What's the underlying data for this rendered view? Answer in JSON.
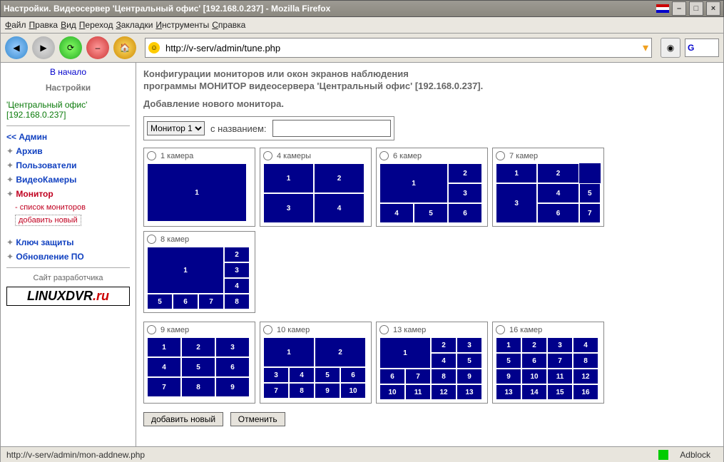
{
  "window_title": "Настройки. Видеосервер 'Центральный офис' [192.168.0.237] - Mozilla Firefox",
  "menu": [
    "Файл",
    "Правка",
    "Вид",
    "Переход",
    "Закладки",
    "Инструменты",
    "Справка"
  ],
  "url": "http://v-serv/admin/tune.php",
  "search_hint": "G",
  "sidebar": {
    "home": "В начало",
    "settings": "Настройки",
    "server_name": "'Центральный офис'",
    "server_ip": "[192.168.0.237]",
    "admin": "<<  Админ",
    "items": [
      {
        "label": "Архив"
      },
      {
        "label": "Пользователи"
      },
      {
        "label": "ВидеоКамеры"
      },
      {
        "label": "Монитор",
        "red": true,
        "subs": [
          {
            "label": "- список мониторов"
          },
          {
            "label": "добавить новый",
            "boxed": true
          }
        ]
      },
      {
        "label": "Ключ защиты"
      },
      {
        "label": "Обновление ПО"
      }
    ],
    "dev": "Сайт разработчика",
    "logo_a": "LINUXDVR",
    "logo_b": ".ru"
  },
  "main": {
    "line1": "Конфигурации мониторов или окон экранов наблюдения",
    "line2": "программы МОНИТОР видеосервера 'Центральный офис' [192.168.0.237].",
    "line3": "Добавление нового монитора.",
    "select_label": "Монитор 1",
    "name_label": "с названием:",
    "name_value": "",
    "layouts": [
      {
        "label": "1 камера",
        "grid": [
          [
            1
          ]
        ],
        "w": 138,
        "h": 80
      },
      {
        "label": "4 камеры",
        "grid": [
          [
            1,
            2
          ],
          [
            3,
            4
          ]
        ],
        "cw": 69,
        "ch": 40
      },
      {
        "label": "6 камер",
        "grid6": true
      },
      {
        "label": "7 камер",
        "grid7": true
      },
      {
        "label": "8 камер",
        "grid8": true
      },
      {
        "label": "9 камер",
        "grid": [
          [
            1,
            2,
            3
          ],
          [
            4,
            5,
            6
          ],
          [
            7,
            8,
            9
          ]
        ],
        "cw": 46,
        "ch": 26
      },
      {
        "label": "10 камер",
        "grid10": true
      },
      {
        "label": "13 камер",
        "grid13": true
      },
      {
        "label": "16 камер",
        "grid": [
          [
            1,
            2,
            3,
            4
          ],
          [
            5,
            6,
            7,
            8
          ],
          [
            9,
            10,
            11,
            12
          ],
          [
            13,
            14,
            15,
            16
          ]
        ],
        "cw": 34,
        "ch": 20
      }
    ],
    "btn_add": "добавить новый",
    "btn_cancel": "Отменить"
  },
  "status": {
    "url": "http://v-serv/admin/mon-addnew.php",
    "adblock": "Adblock"
  }
}
